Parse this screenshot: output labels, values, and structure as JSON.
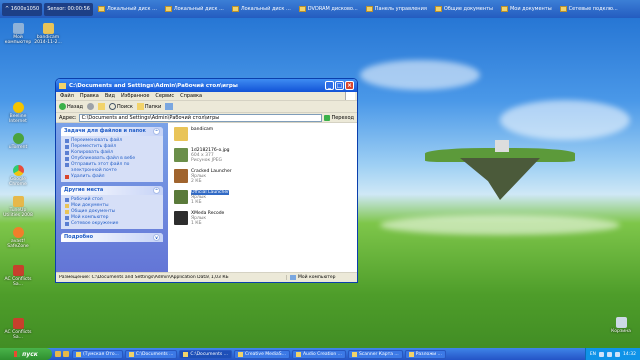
{
  "top_taskbar": {
    "items": [
      {
        "label": "^ 1600x1050"
      },
      {
        "label": "Sensor: 00:00:56"
      },
      {
        "label": "Локальный диск ..."
      },
      {
        "label": "Локальный диск ..."
      },
      {
        "label": "Локальный диск ..."
      },
      {
        "label": "DVDRAM дисково..."
      },
      {
        "label": "Панель управления"
      },
      {
        "label": "Общие документы"
      },
      {
        "label": "Мои документы"
      },
      {
        "label": "Сетевые подклю..."
      }
    ]
  },
  "desktop_icons": [
    {
      "label": "Мой компьютер"
    },
    {
      "label": "bandicam 2014-11-2..."
    },
    {
      "label": "Beeline Internet"
    },
    {
      "label": "uTorrent"
    },
    {
      "label": "Google Chrome"
    },
    {
      "label": "TuneUp Utilities 2008"
    },
    {
      "label": "avast! SafeZone"
    },
    {
      "label": "AC Conflicts Sa..."
    },
    {
      "label": "AC Conflicts Sa..."
    },
    {
      "label": "Корзина"
    }
  ],
  "window": {
    "title": "C:\\Documents and Settings\\Admin\\Рабочий стол\\игры",
    "menu": [
      "Файл",
      "Правка",
      "Вид",
      "Избранное",
      "Сервис",
      "Справка"
    ],
    "toolbar": {
      "back": "Назад",
      "search": "Поиск",
      "folders": "Папки"
    },
    "address": {
      "label": "Адрес:",
      "value": "C:\\Documents and Settings\\Admin\\Рабочий стол\\игры",
      "go": "Переход"
    },
    "tasks_panel": {
      "title": "Задачи для файлов и папок",
      "items": [
        "Переименовать файл",
        "Переместить файл",
        "Копировать файл",
        "Опубликовать файл в вебе",
        "Отправить этот файл по электронной почте",
        "Удалить файл"
      ]
    },
    "places_panel": {
      "title": "Другие места",
      "items": [
        "Рабочий стол",
        "Мои документы",
        "Общие документы",
        "Мой компьютер",
        "Сетевое окружение"
      ]
    },
    "details_panel": {
      "title": "Подробно"
    },
    "files": [
      {
        "name": "bandicam",
        "size": "",
        "type": "",
        "thumb": "#e9c458",
        "selected": false
      },
      {
        "name": "1d2182176-o.jpg",
        "size": "604 x 377",
        "type": "Рисунок JPEG",
        "thumb": "#6b8f4a",
        "selected": false
      },
      {
        "name": "Cracked Launcher",
        "size": "Ярлык",
        "type": "2 КБ",
        "thumb": "#a0642e",
        "selected": false
      },
      {
        "name": "Official Launcher",
        "size": "Ярлык",
        "type": "1 КБ",
        "thumb": "#5a7a3a",
        "selected": true
      },
      {
        "name": "XMeda Recode",
        "size": "Ярлык",
        "type": "1 КБ",
        "thumb": "#2d2d2d",
        "selected": false
      }
    ],
    "status": {
      "text": "Размещение: C:\\Documents and Settings\\Admin\\Application Data\\ 1,03 КБ",
      "computer": "Мой компьютер"
    }
  },
  "taskbar": {
    "start": "пуск",
    "tasks": [
      {
        "label": "(Тумская Ото...",
        "active": false
      },
      {
        "label": "C:\\Documents ...",
        "active": false
      },
      {
        "label": "C:\\Documents ...",
        "active": true
      },
      {
        "label": "Creative MediaS...",
        "active": false
      },
      {
        "label": "Audio Creation ...",
        "active": false
      },
      {
        "label": "Scanner Карта ...",
        "active": false
      },
      {
        "label": "Разложи ...",
        "active": false
      }
    ],
    "tray": {
      "lang": "EN",
      "time": "14:32"
    }
  }
}
